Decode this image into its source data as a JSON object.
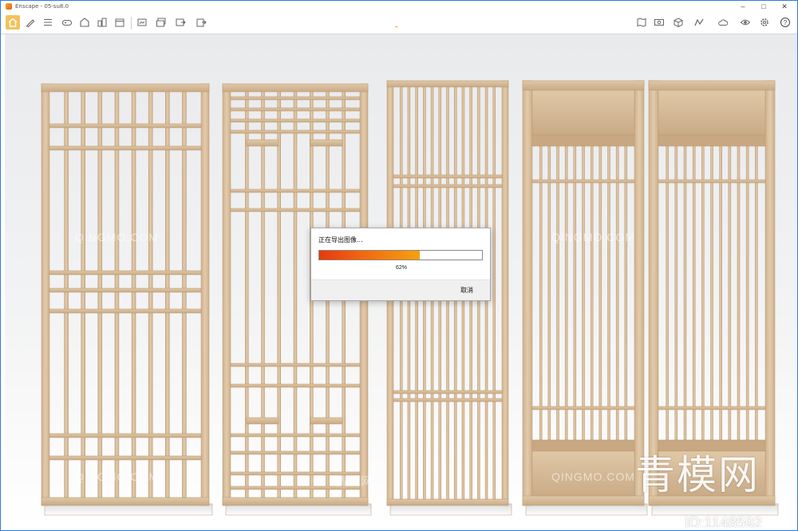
{
  "window": {
    "title": "Enscape - 05-su8.0"
  },
  "toolbar": {
    "left_icons": [
      "home-icon",
      "pencil-icon",
      "list-icon",
      "gamepad-icon",
      "house-icon",
      "building-icon",
      "film-icon",
      "screenshot-icon",
      "batch-icon",
      "export-icon",
      "upload-icon"
    ],
    "right_icons": [
      "map-icon",
      "panorama-icon",
      "cube-icon",
      "chart-icon",
      "cloud-icon",
      "settings-icon",
      "eye-icon",
      "gear-icon",
      "help-icon"
    ]
  },
  "dialog": {
    "title": "正在导出图像...",
    "progress": 0.62,
    "progress_label": "62%",
    "cancel_label": "取消"
  },
  "watermarks": {
    "site": "QINGMO.COM",
    "logo": "青模网",
    "id": "ID:1148592"
  },
  "colors": {
    "accent": "#2c7be5",
    "home_highlight": "#f3c25d",
    "progress_start": "#e8380d",
    "progress_end": "#f7a10c",
    "wood": "#dcc3a3"
  }
}
